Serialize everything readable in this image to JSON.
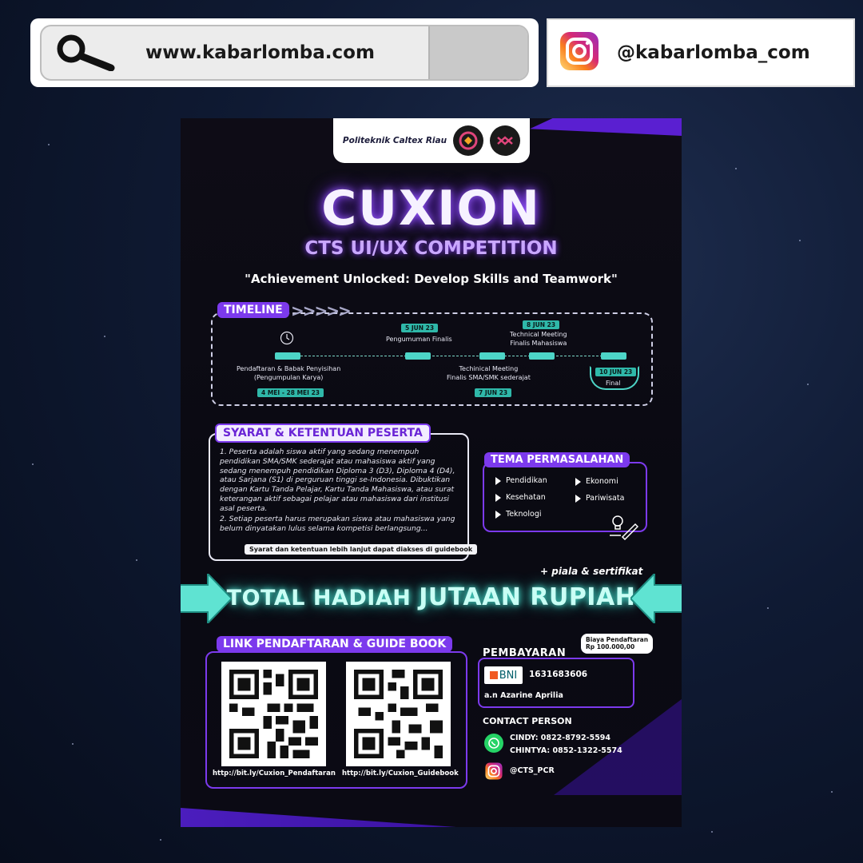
{
  "header": {
    "url": "www.kabarlomba.com",
    "instagram_handle": "@kabarlomba_com"
  },
  "poster": {
    "institution": "Politeknik Caltex Riau",
    "brand": "CUXION",
    "subtitle": "CTS UI/UX COMPETITION",
    "tagline": "\"Achievement Unlocked: Develop Skills and Teamwork\"",
    "timeline": {
      "title": "TIMELINE",
      "events": [
        {
          "label_line1": "Pendaftaran & Babak Penyisihan",
          "label_line2": "(Pengumpulan Karya)",
          "date": "4 MEI - 28 MEI 23"
        },
        {
          "label_line1": "Pengumuman Finalis",
          "label_line2": "",
          "date": "5 JUN 23"
        },
        {
          "label_line1": "Techinical Meeting",
          "label_line2": "Finalis SMA/SMK sederajat",
          "date": "7 JUN 23"
        },
        {
          "label_line1": "Technical Meeting",
          "label_line2": "Finalis Mahasiswa",
          "date": "8 JUN 23"
        },
        {
          "label_line1": "Final",
          "label_line2": "",
          "date": "10 JUN 23"
        }
      ]
    },
    "syarat": {
      "title": "SYARAT & KETENTUAN PESERTA",
      "items": [
        "1. Peserta adalah siswa aktif yang sedang menempuh pendidikan SMA/SMK sederajat atau mahasiswa aktif yang sedang menempuh pendidikan Diploma 3 (D3), Diploma 4 (D4), atau Sarjana (S1) di perguruan tinggi se-Indonesia. Dibuktikan dengan Kartu Tanda Pelajar, Kartu Tanda Mahasiswa, atau surat keterangan aktif sebagai pelajar atau mahasiswa dari institusi asal peserta.",
        "2. Setiap peserta harus merupakan siswa atau mahasiswa yang belum dinyatakan lulus selama kompetisi berlangsung..."
      ],
      "note": "Syarat dan ketentuan lebih lanjut dapat diakses di guidebook"
    },
    "tema": {
      "title": "TEMA PERMASALAHAN",
      "items": [
        "Pendidikan",
        "Ekonomi",
        "Kesehatan",
        "Pariwisata",
        "Teknologi"
      ]
    },
    "hadiah": {
      "extra": "+ piala & sertifikat",
      "text_part1": "TOTAL HADIAH",
      "text_part2": "JUTAAN RUPIAH"
    },
    "links": {
      "title": "LINK PENDAFTARAN & GUIDE BOOK",
      "pendaftaran": "http://bit.ly/Cuxion_Pendaftaran",
      "guidebook": "http://bit.ly/Cuxion_Guidebook"
    },
    "pembayaran": {
      "title": "PEMBAYARAN",
      "biaya_label": "Biaya Pendaftaran",
      "biaya_value": "Rp 100.000,00",
      "bank": "BNI",
      "account": "1631683606",
      "account_name": "a.n Azarine Aprilia"
    },
    "contact": {
      "title": "CONTACT PERSON",
      "person1": "CINDY: 0822-8792-5594",
      "person2": "CHINTYA: 0852-1322-5574",
      "instagram": "@CTS_PCR"
    }
  },
  "colors": {
    "accent_purple": "#7c3aed",
    "teal": "#4dd5c7",
    "background": "#0f1a33"
  }
}
